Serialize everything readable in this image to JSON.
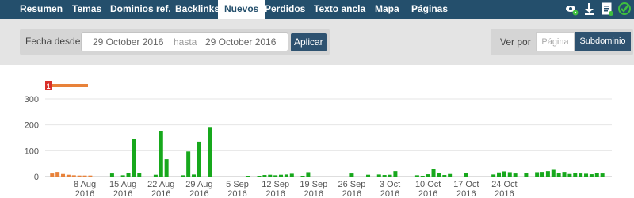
{
  "nav": {
    "tabs": [
      {
        "label": "Resumen",
        "active": false
      },
      {
        "label": "Temas",
        "active": false
      },
      {
        "label": "Dominios ref.",
        "active": false
      },
      {
        "label": "Backlinks",
        "active": false
      },
      {
        "label": "Nuevos",
        "active": true
      },
      {
        "label": "Perdidos",
        "active": false
      },
      {
        "label": "Texto ancla",
        "active": false
      },
      {
        "label": "Mapa",
        "active": false
      },
      {
        "label": "Páginas",
        "active": false
      }
    ],
    "icons": [
      "eye-settings-icon",
      "download-icon",
      "report-icon",
      "verified-check-icon"
    ],
    "bg_color": "#244f6c"
  },
  "filter": {
    "date_label": "Fecha desde",
    "date_from": "29 October 2016",
    "date_separator": "hasta",
    "date_to": "29 October 2016",
    "apply_label": "Aplicar",
    "view_label": "Ver por",
    "view_options": [
      {
        "label": "Página",
        "selected": false
      },
      {
        "label": "Subdominio",
        "selected": true
      }
    ]
  },
  "chart_data": {
    "type": "bar",
    "title": "",
    "xlabel": "",
    "ylabel": "",
    "ylim": [
      0,
      350
    ],
    "yticks": [
      0,
      100,
      200,
      300
    ],
    "grid": true,
    "x_ticks": [
      {
        "label": "8 Aug 2016",
        "day": 7
      },
      {
        "label": "15 Aug 2016",
        "day": 14
      },
      {
        "label": "22 Aug 2016",
        "day": 21
      },
      {
        "label": "29 Aug 2016",
        "day": 28
      },
      {
        "label": "5 Sep 2016",
        "day": 35
      },
      {
        "label": "12 Sep 2016",
        "day": 42
      },
      {
        "label": "19 Sep 2016",
        "day": 49
      },
      {
        "label": "26 Sep 2016",
        "day": 56
      },
      {
        "label": "3 Oct 2016",
        "day": 63
      },
      {
        "label": "10 Oct 2016",
        "day": 70
      },
      {
        "label": "17 Oct 2016",
        "day": 77
      },
      {
        "label": "24 Oct 2016",
        "day": 84
      }
    ],
    "marker": {
      "label": "1",
      "color": "#e8823a",
      "badge_color": "#d9302a"
    },
    "series": [
      {
        "color": "#e8823a",
        "points": [
          [
            1,
            12
          ],
          [
            2,
            18
          ],
          [
            3,
            10
          ],
          [
            4,
            7
          ],
          [
            5,
            5
          ],
          [
            6,
            4
          ],
          [
            7,
            4
          ],
          [
            8,
            4
          ]
        ]
      },
      {
        "color": "#17a81c",
        "points": [
          [
            12,
            12
          ],
          [
            14,
            5
          ],
          [
            15,
            14
          ],
          [
            16,
            146
          ],
          [
            17,
            15
          ],
          [
            20,
            7
          ],
          [
            21,
            175
          ],
          [
            22,
            67
          ],
          [
            25,
            5
          ],
          [
            26,
            97
          ],
          [
            27,
            8
          ],
          [
            28,
            135
          ],
          [
            30,
            192
          ],
          [
            37,
            3
          ],
          [
            39,
            3
          ],
          [
            40,
            6
          ],
          [
            41,
            7
          ],
          [
            42,
            5
          ],
          [
            43,
            7
          ],
          [
            44,
            8
          ],
          [
            45,
            11
          ],
          [
            47,
            3
          ],
          [
            48,
            17
          ],
          [
            56,
            12
          ],
          [
            59,
            7
          ],
          [
            61,
            8
          ],
          [
            62,
            6
          ],
          [
            63,
            7
          ],
          [
            64,
            21
          ],
          [
            68,
            5
          ],
          [
            69,
            3
          ],
          [
            70,
            9
          ],
          [
            71,
            28
          ],
          [
            72,
            13
          ],
          [
            73,
            6
          ],
          [
            74,
            10
          ],
          [
            77,
            15
          ],
          [
            82,
            8
          ],
          [
            83,
            16
          ],
          [
            84,
            20
          ],
          [
            85,
            17
          ],
          [
            86,
            12
          ],
          [
            88,
            15
          ],
          [
            90,
            17
          ],
          [
            91,
            18
          ],
          [
            92,
            21
          ],
          [
            93,
            26
          ],
          [
            94,
            14
          ],
          [
            95,
            18
          ],
          [
            96,
            10
          ],
          [
            97,
            15
          ],
          [
            98,
            12
          ],
          [
            99,
            11
          ],
          [
            100,
            9
          ],
          [
            101,
            15
          ],
          [
            102,
            12
          ]
        ]
      }
    ]
  }
}
